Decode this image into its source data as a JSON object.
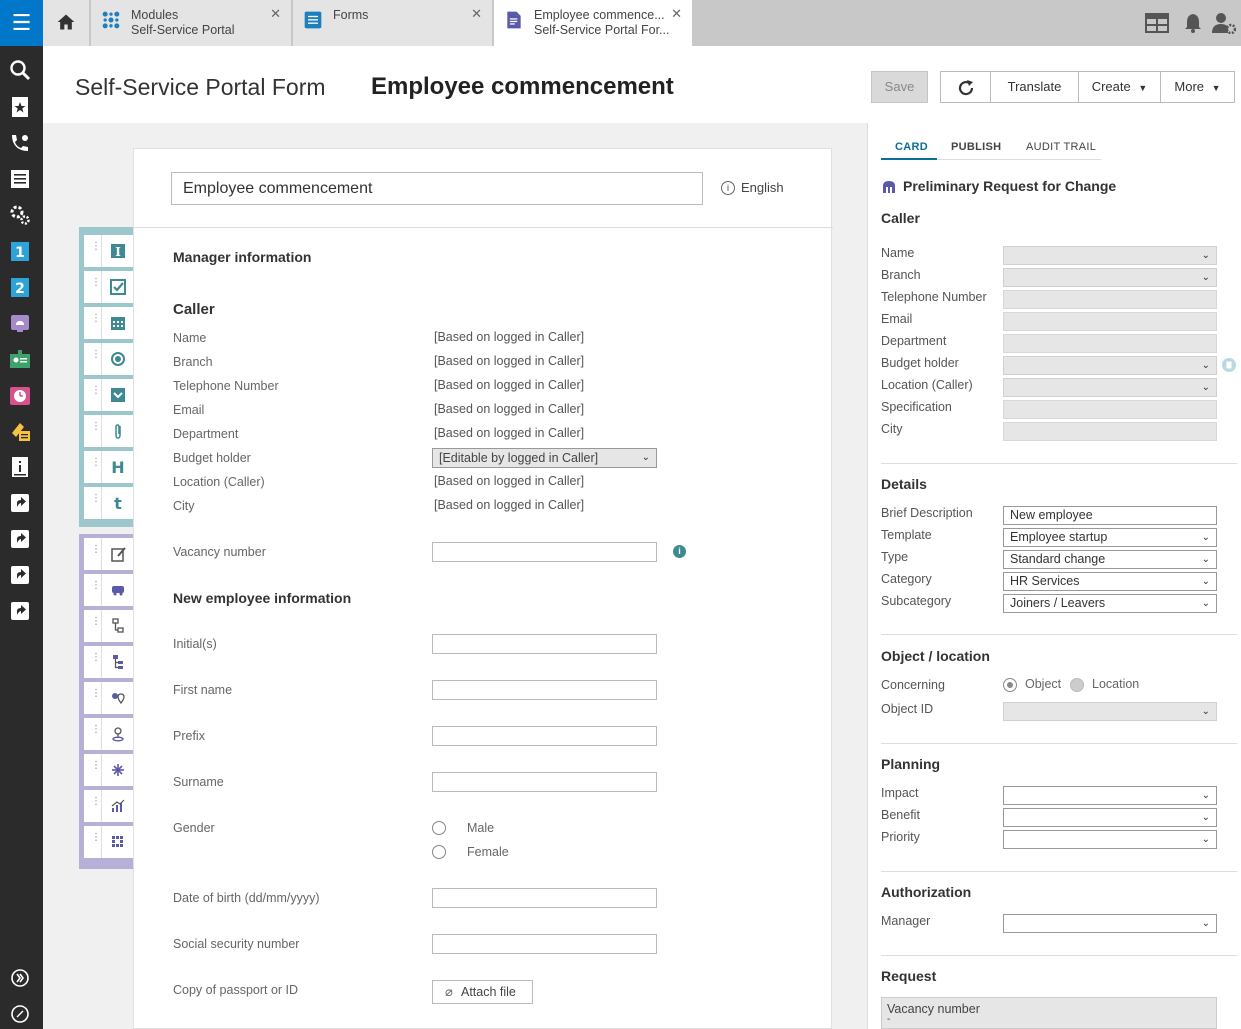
{
  "tabs": [
    {
      "line1": "Modules",
      "line2": "Self-Service Portal"
    },
    {
      "line1": "Forms",
      "line2": ""
    },
    {
      "line1": "Employee commence...",
      "line2": "Self-Service Portal For..."
    }
  ],
  "header": {
    "subtitle": "Self-Service Portal Form",
    "title": "Employee commencement",
    "save": "Save",
    "translate": "Translate",
    "create": "Create",
    "more": "More"
  },
  "form": {
    "name_value": "Employee commencement",
    "language": "English",
    "section1": "Manager information",
    "caller_heading": "Caller",
    "caller_fields": [
      {
        "label": "Name",
        "value": "[Based on logged in Caller]"
      },
      {
        "label": "Branch",
        "value": "[Based on logged in Caller]"
      },
      {
        "label": "Telephone Number",
        "value": "[Based on logged in Caller]"
      },
      {
        "label": "Email",
        "value": "[Based on logged in Caller]"
      },
      {
        "label": "Department",
        "value": "[Based on logged in Caller]"
      },
      {
        "label": "Budget holder",
        "value": "[Editable by logged in Caller]"
      },
      {
        "label": "Location (Caller)",
        "value": "[Based on logged in Caller]"
      },
      {
        "label": "City",
        "value": "[Based on logged in Caller]"
      }
    ],
    "vacancy_label": "Vacancy number",
    "section2": "New employee information",
    "initials_label": "Initial(s)",
    "firstname_label": "First name",
    "prefix_label": "Prefix",
    "surname_label": "Surname",
    "gender_label": "Gender",
    "gender_options": [
      "Male",
      "Female"
    ],
    "dob_label": "Date of birth (dd/mm/yyyy)",
    "ssn_label": "Social security number",
    "passport_label": "Copy of passport or ID",
    "attach_label": "Attach file"
  },
  "panel": {
    "tabs": [
      "CARD",
      "PUBLISH",
      "AUDIT TRAIL"
    ],
    "title": "Preliminary Request for Change",
    "caller_heading": "Caller",
    "caller_fields": [
      "Name",
      "Branch",
      "Telephone Number",
      "Email",
      "Department",
      "Budget holder",
      "Location (Caller)",
      "Specification",
      "City"
    ],
    "details_heading": "Details",
    "brief_label": "Brief Description",
    "brief_value": "New employee",
    "template_label": "Template",
    "template_value": "Employee startup",
    "type_label": "Type",
    "type_value": "Standard change",
    "category_label": "Category",
    "category_value": "HR Services",
    "subcategory_label": "Subcategory",
    "subcategory_value": "Joiners / Leavers",
    "object_heading": "Object / location",
    "concerning_label": "Concerning",
    "concerning_options": [
      "Object",
      "Location"
    ],
    "objectid_label": "Object ID",
    "planning_heading": "Planning",
    "impact_label": "Impact",
    "benefit_label": "Benefit",
    "priority_label": "Priority",
    "auth_heading": "Authorization",
    "manager_label": "Manager",
    "request_heading": "Request",
    "request_text": "Vacancy number",
    "request_value": "-"
  }
}
